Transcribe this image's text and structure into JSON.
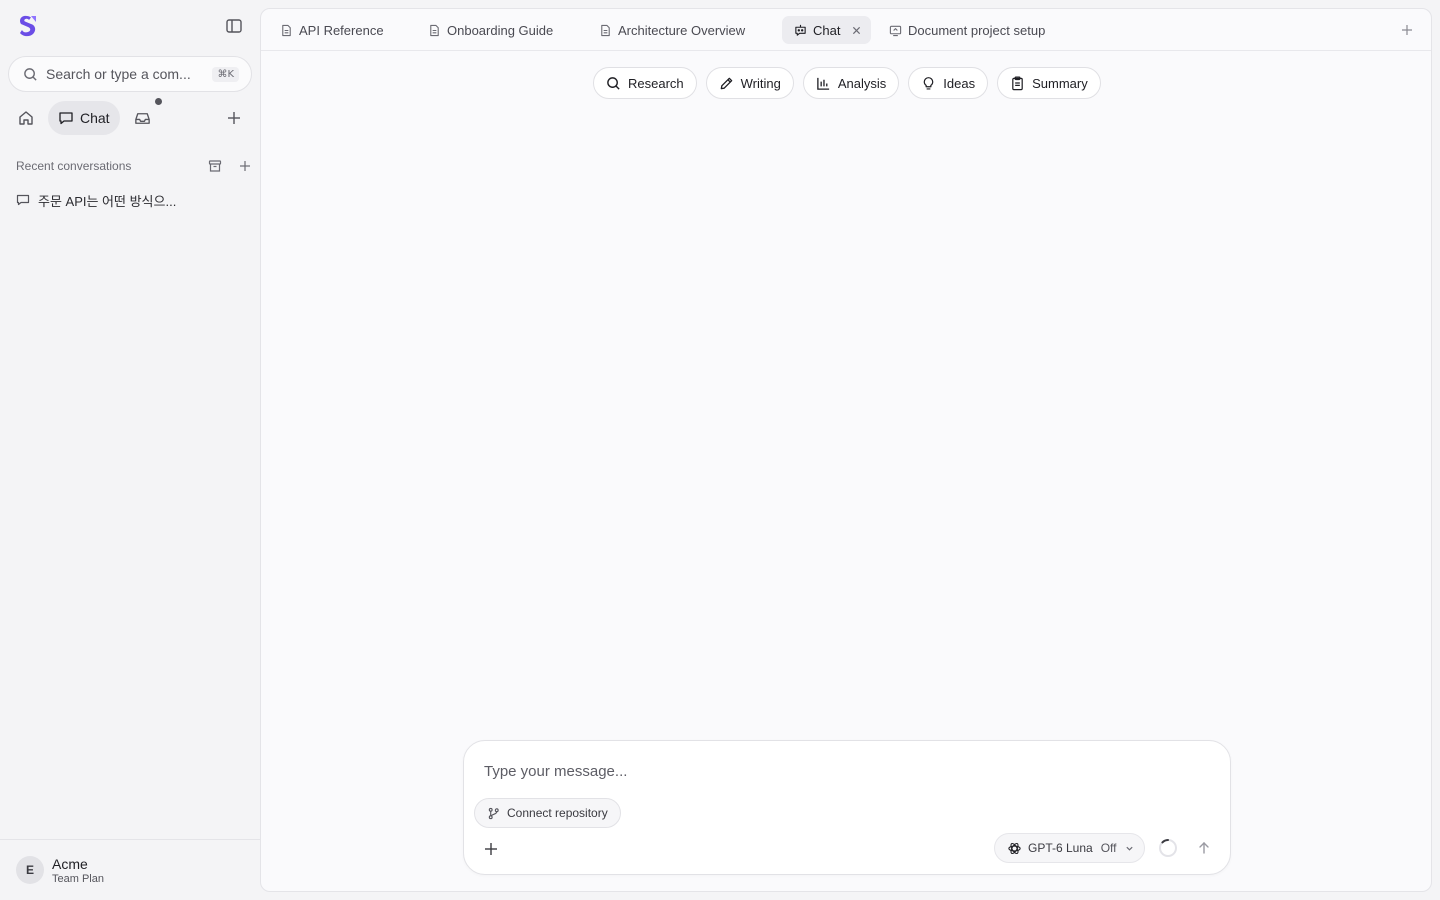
{
  "sidebar": {
    "search_placeholder": "Search or type a com...",
    "search_shortcut": "⌘K",
    "nav": {
      "chat_label": "Chat"
    },
    "recent_label": "Recent conversations",
    "conversations": [
      {
        "title": "주문 API는 어떤 방식으..."
      }
    ],
    "footer": {
      "avatar_initial": "E",
      "name": "Acme",
      "plan": "Team Plan"
    }
  },
  "tabs": [
    {
      "label": "API Reference",
      "icon": "document-icon"
    },
    {
      "label": "Onboarding Guide",
      "icon": "document-icon"
    },
    {
      "label": "Architecture Overview",
      "icon": "document-icon"
    },
    {
      "label": "Chat",
      "icon": "chat-bot-icon",
      "active": true
    },
    {
      "label": "Document project setup",
      "icon": "screen-share-icon"
    }
  ],
  "chips": [
    {
      "label": "Research",
      "icon": "search-icon"
    },
    {
      "label": "Writing",
      "icon": "pencil-icon"
    },
    {
      "label": "Analysis",
      "icon": "bar-chart-icon"
    },
    {
      "label": "Ideas",
      "icon": "lightbulb-icon"
    },
    {
      "label": "Summary",
      "icon": "clipboard-icon"
    }
  ],
  "composer": {
    "placeholder": "Type your message...",
    "repo_label": "Connect repository",
    "model_name": "GPT-6 Luna",
    "model_mode": "Off"
  },
  "colors": {
    "accent": "#6b4de6",
    "sidebar_bg": "#f4f4f6",
    "panel_bg": "#fafafc"
  }
}
